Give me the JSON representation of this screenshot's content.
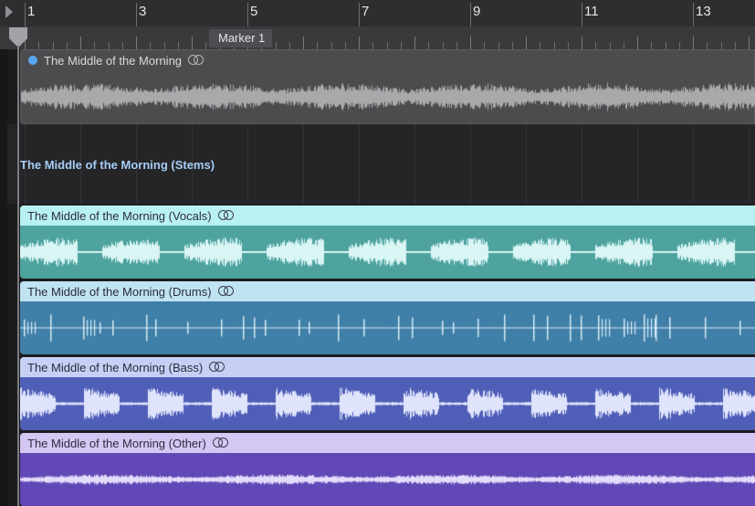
{
  "ruler": {
    "bars": [
      "1",
      "3",
      "5",
      "7",
      "9",
      "11",
      "13"
    ]
  },
  "marker": {
    "label": "Marker 1"
  },
  "tracks": {
    "main": {
      "name": "The Middle of the Morning",
      "dot_color": "#5aa6f0",
      "icon": "loop-icon"
    },
    "folder": {
      "name": "The Middle of the Morning (Stems)",
      "label_color": "#a7cdf6"
    },
    "stems": [
      {
        "name": "The Middle of the Morning (Vocals)",
        "icon": "loop-icon",
        "header_color": "#b8f1f1",
        "body_color": "#4ea39e"
      },
      {
        "name": "The Middle of the Morning (Drums)",
        "icon": "loop-icon",
        "header_color": "#bfe3f3",
        "body_color": "#3f7fa8"
      },
      {
        "name": "The Middle of the Morning (Bass)",
        "icon": "loop-icon",
        "header_color": "#c6d0f5",
        "body_color": "#4f5fb8"
      },
      {
        "name": "The Middle of the Morning (Other)",
        "icon": "loop-icon",
        "header_color": "#d4c7f4",
        "body_color": "#6248b6"
      }
    ]
  }
}
